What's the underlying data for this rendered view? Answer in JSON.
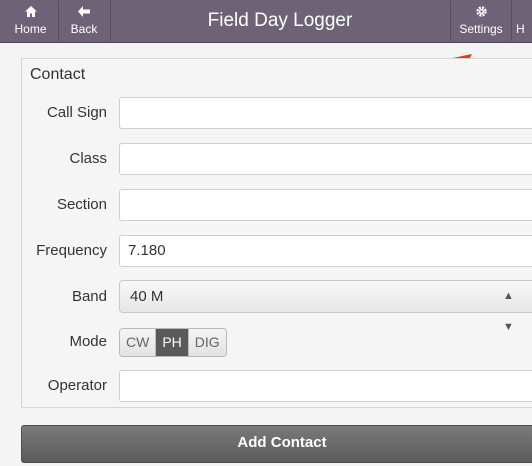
{
  "header": {
    "title": "Field Day Logger",
    "home_label": "Home",
    "back_label": "Back",
    "settings_label": "Settings",
    "more_label": "H"
  },
  "form": {
    "legend": "Contact",
    "fields": {
      "call_sign": {
        "label": "Call Sign",
        "value": ""
      },
      "class": {
        "label": "Class",
        "value": ""
      },
      "section": {
        "label": "Section",
        "value": ""
      },
      "frequency": {
        "label": "Frequency",
        "value": "7.180"
      },
      "band": {
        "label": "Band",
        "value": "40 M"
      },
      "mode": {
        "label": "Mode",
        "options": [
          "CW",
          "PH",
          "DIG"
        ],
        "selected": "PH"
      },
      "operator": {
        "label": "Operator",
        "value": ""
      }
    },
    "submit_label": "Add Contact"
  },
  "colors": {
    "header_bg": "#6e6376",
    "arrow": "#ee3322",
    "button_bg": "#666666"
  }
}
